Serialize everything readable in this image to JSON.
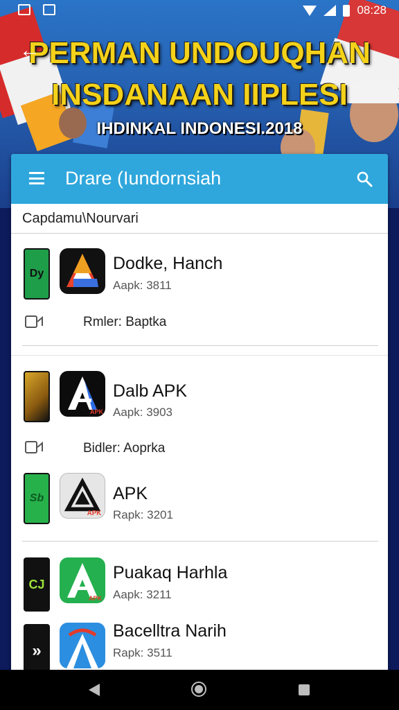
{
  "status_bar": {
    "time": "08:28"
  },
  "banner": {
    "title_line1": "PERMAN UNDOUQHAN",
    "title_line2": "INSDANAAN IIPLESI",
    "subtitle": "IHDINKAL INDONESI.2018"
  },
  "app_bar": {
    "title": "Drare (Iundornsiah"
  },
  "section_label": "Capdamu\\Nourvari",
  "apps": [
    {
      "name": "Dodke, Hanch",
      "size": "Aapk: 3811",
      "meta": "Rmler:  Baptka",
      "thumb_text": "Dy",
      "thumb_color": "#1f9e4a"
    },
    {
      "name": "Dalb APK",
      "size": "Aapk: 3903",
      "meta": "Bidler:  Aoprka",
      "thumb_text": "",
      "thumb_color": "#d8a62a"
    },
    {
      "name": "APK",
      "size": "Rapk: 3201",
      "thumb_text": "Sb",
      "thumb_color": "#27b14a"
    },
    {
      "name": "Puakaq Harhla",
      "size": "Aapk: 3211",
      "thumb_text": "CJ",
      "thumb_color": "#111111"
    },
    {
      "name": "Bacelltra Narih",
      "size": "Rapk: 3511",
      "thumb_text": "»",
      "thumb_color": "#111111"
    }
  ],
  "icon_badge": "APK",
  "colors": {
    "app_bar": "#2fa7dc",
    "banner_title": "#f4d21a",
    "nav_bar": "#000000"
  }
}
